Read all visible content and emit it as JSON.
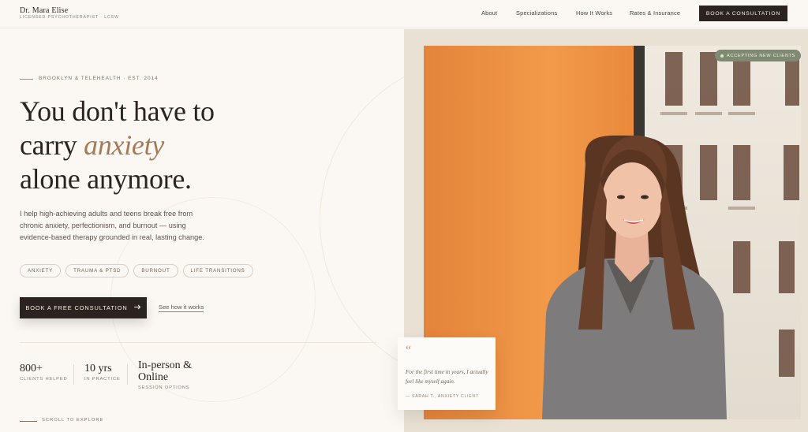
{
  "header": {
    "brand_name": "Dr. Mara Elise",
    "brand_subtitle": "LICENSED PSYCHOTHERAPIST · LCSW",
    "nav": [
      "About",
      "Specializations",
      "How It Works",
      "Rates & Insurance"
    ],
    "cta_label": "BOOK A CONSULTATION"
  },
  "hero": {
    "eyebrow": "BROOKLYN & TELEHEALTH · EST. 2014",
    "headline": {
      "line1": "You don't have to",
      "line2_prefix": "carry ",
      "line2_accent": "anxiety",
      "line3": "alone anymore."
    },
    "body": "I help high-achieving adults and teens break free from chronic anxiety, perfectionism, and burnout — using evidence-based therapy grounded in real, lasting change.",
    "tags": [
      "ANXIETY",
      "TRAUMA & PTSD",
      "BURNOUT",
      "LIFE TRANSITIONS"
    ],
    "primary_cta": "BOOK A FREE CONSULTATION",
    "primary_cta_icon": "arrow-right-icon",
    "secondary_cta": "See how it works",
    "stats": [
      {
        "value": "800+",
        "label": "CLIENTS HELPED"
      },
      {
        "value": "10 yrs",
        "label": "IN PRACTICE"
      },
      {
        "value": "In-person & Online",
        "label": "SESSION OPTIONS"
      }
    ],
    "scroll_hint": "SCROLL TO EXPLORE"
  },
  "photo": {
    "badge": "ACCEPTING NEW CLIENTS",
    "quote": {
      "mark": "“",
      "text": "For the first time in years, I actually feel like myself again.",
      "author": "— SARAH T., ANXIETY CLIENT"
    }
  },
  "colors": {
    "background": "#fbf8f3",
    "ink": "#2b2320",
    "accent": "#a57a57",
    "badge": "#7f8a72"
  }
}
